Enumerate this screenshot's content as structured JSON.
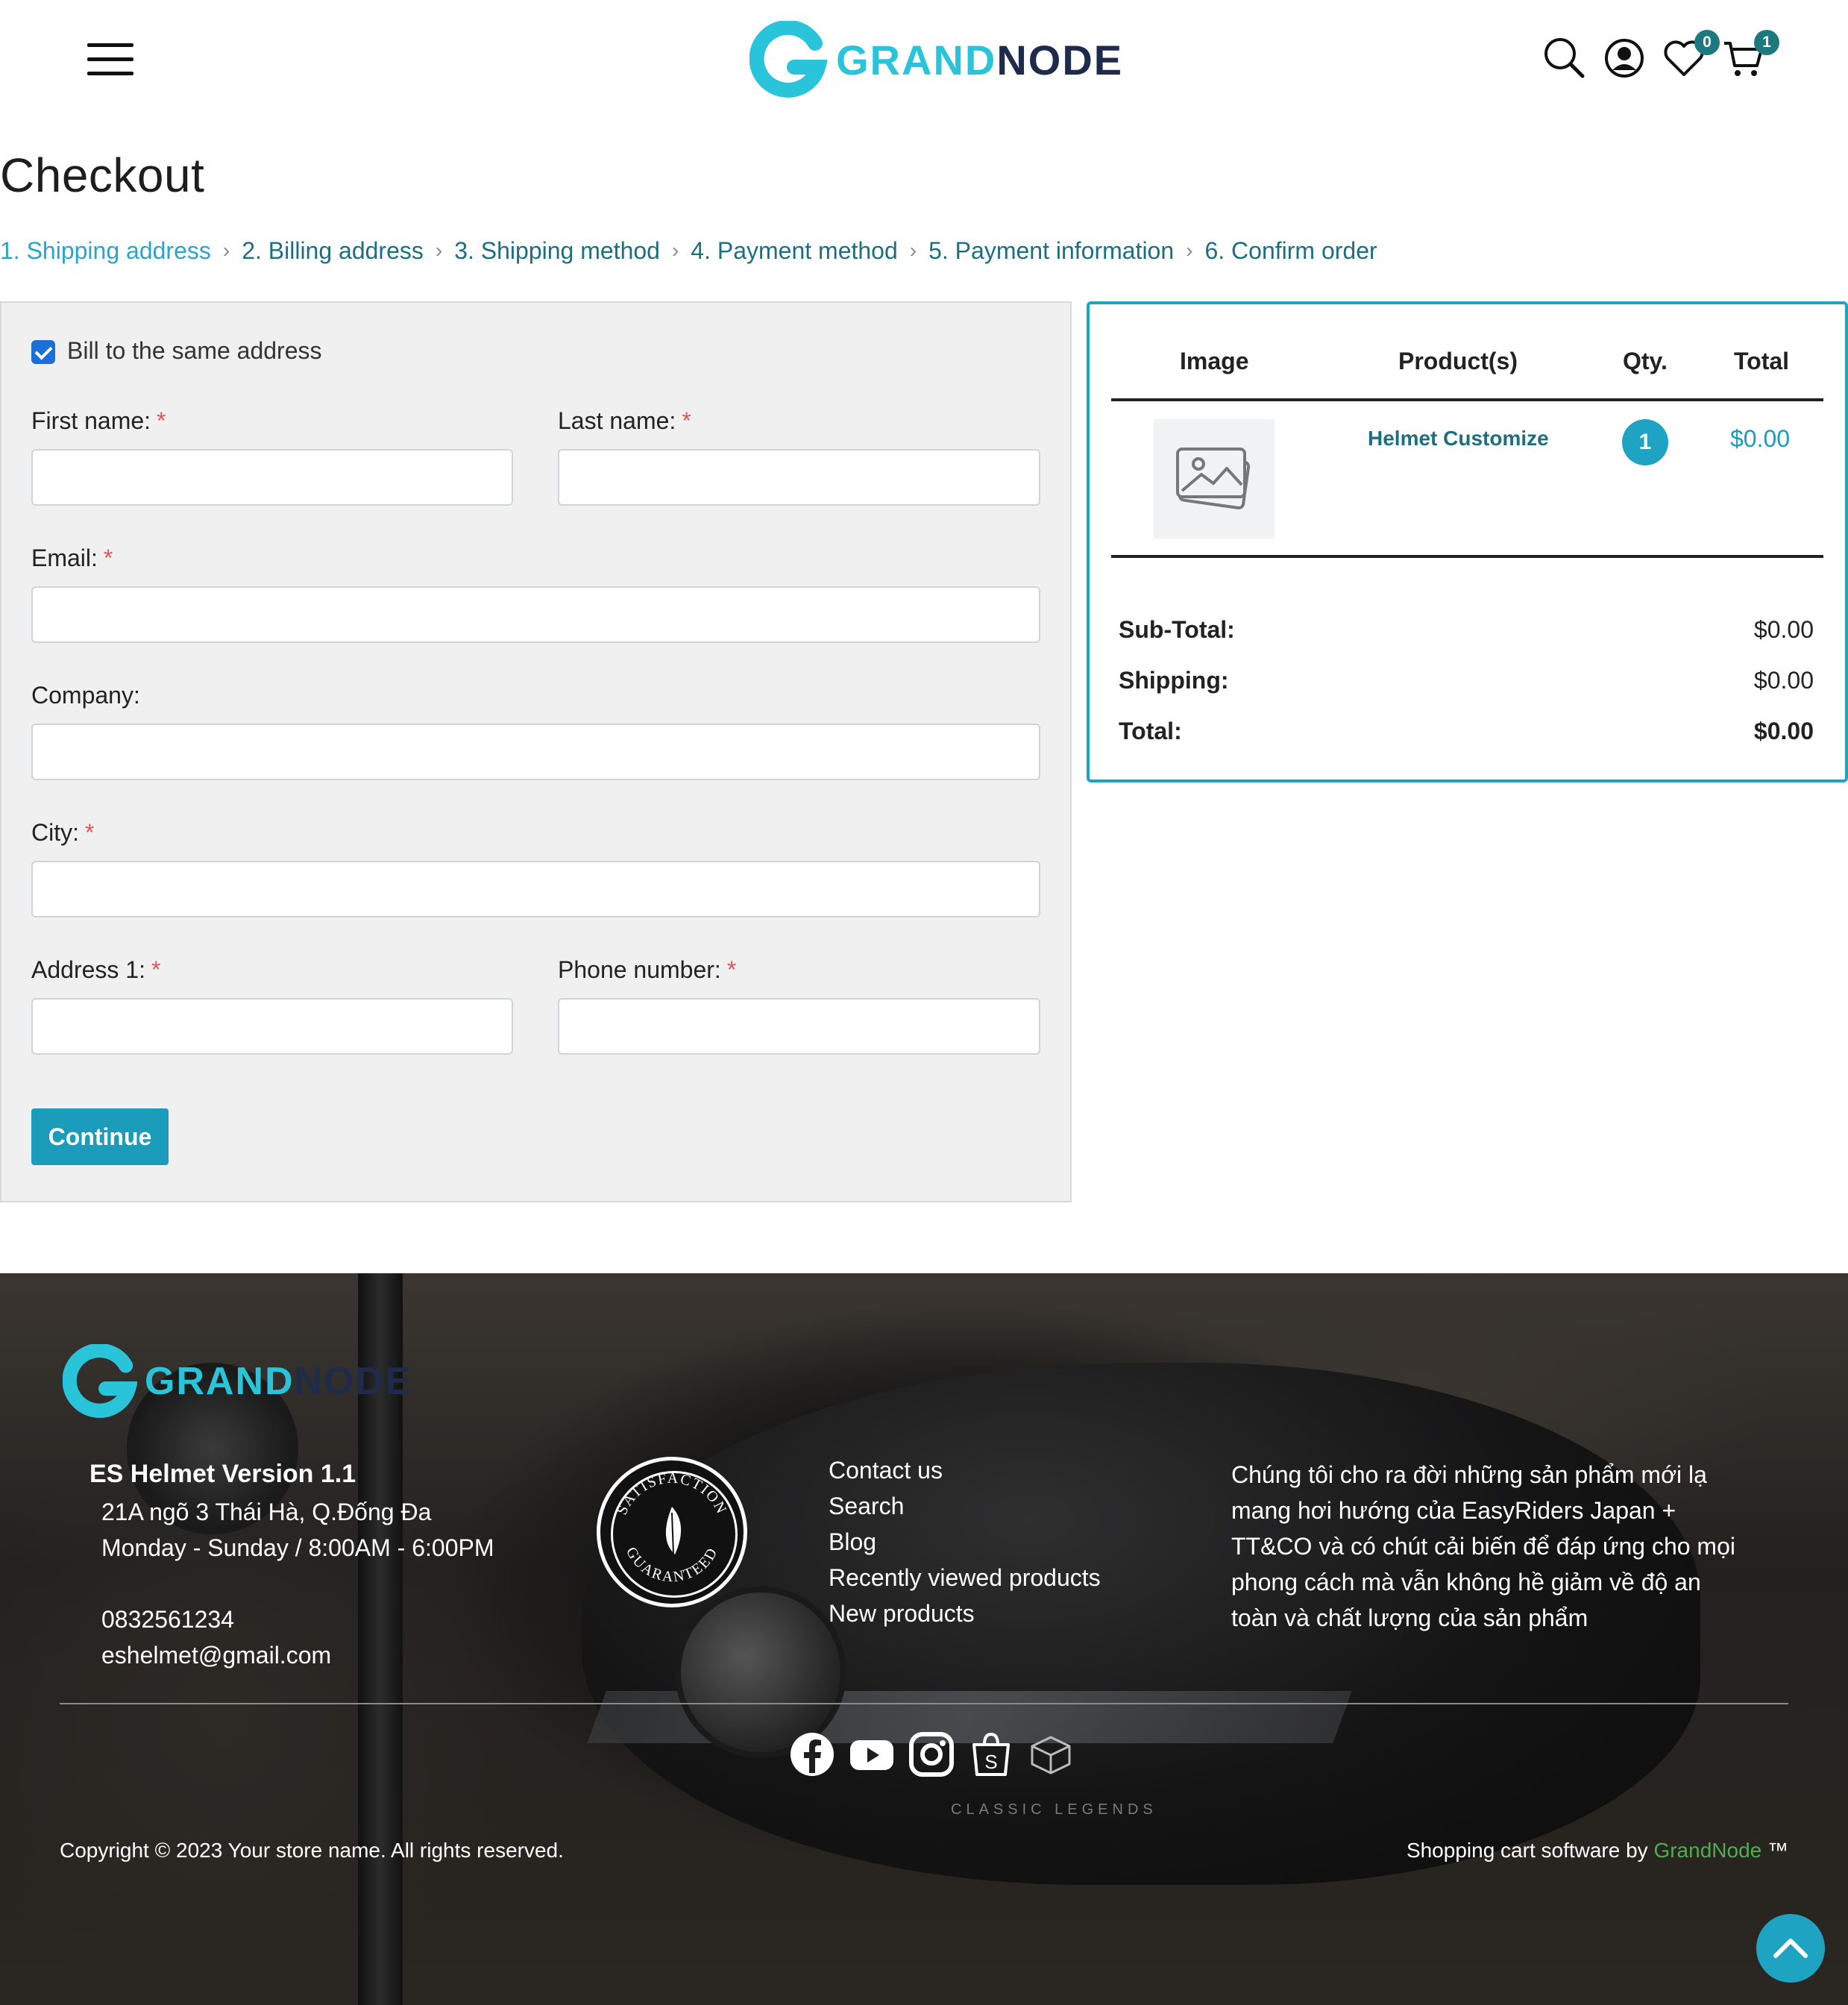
{
  "header": {
    "logo_part1": "GRAND",
    "logo_part2": "NODE",
    "wishlist_count": "0",
    "cart_count": "1"
  },
  "page": {
    "title": "Checkout",
    "steps": [
      {
        "label": "1. Shipping address",
        "active": true
      },
      {
        "label": "2. Billing address",
        "active": false
      },
      {
        "label": "3. Shipping method",
        "active": false
      },
      {
        "label": "4. Payment method",
        "active": false
      },
      {
        "label": "5. Payment information",
        "active": false
      },
      {
        "label": "6. Confirm order",
        "active": false
      }
    ]
  },
  "form": {
    "bill_same_label": "Bill to the same address",
    "bill_same_checked": true,
    "first_name_label": "First name:",
    "last_name_label": "Last name:",
    "email_label": "Email:",
    "company_label": "Company:",
    "city_label": "City:",
    "address1_label": "Address 1:",
    "phone_label": "Phone number:",
    "required_mark": "*",
    "first_name_value": "",
    "last_name_value": "",
    "email_value": "",
    "company_value": "",
    "city_value": "",
    "address1_value": "",
    "phone_value": "",
    "continue_label": "Continue"
  },
  "summary": {
    "headers": {
      "image": "Image",
      "product": "Product(s)",
      "qty": "Qty.",
      "total": "Total"
    },
    "items": [
      {
        "name": "Helmet Customize",
        "qty": "1",
        "total": "$0.00"
      }
    ],
    "subtotal_label": "Sub-Total:",
    "subtotal_value": "$0.00",
    "shipping_label": "Shipping:",
    "shipping_value": "$0.00",
    "total_label": "Total:",
    "total_value": "$0.00"
  },
  "footer": {
    "logo_part1": "GRAND",
    "logo_part2": "NODE",
    "store_name": "ES Helmet Version 1.1",
    "address": "21A ngõ 3 Thái Hà, Q.Đống Đa",
    "hours": "Monday - Sunday / 8:00AM - 6:00PM",
    "phone": "0832561234",
    "email": "eshelmet@gmail.com",
    "seal_top": "SATISFACTION",
    "seal_bottom": "GUARANTEED",
    "links": [
      "Contact us",
      "Search",
      "Blog",
      "Recently viewed products",
      "New products"
    ],
    "description": "Chúng tôi cho ra đời những sản phẩm mới lạ mang hơi hướng của EasyRiders Japan + TT&CO và có chút cải biến để đáp ứng cho mọi phong cách mà vẫn không hề giảm về độ an toàn và chất lượng của sản phẩm",
    "background_text": "CLASSIC LEGENDS",
    "social": [
      "facebook-icon",
      "youtube-icon",
      "instagram-icon",
      "shopee-icon",
      "box-icon"
    ],
    "copyright": "Copyright © 2023 Your store name. All rights reserved.",
    "powered_prefix": "Shopping cart software by ",
    "powered_link": "GrandNode",
    "powered_suffix": " ™"
  },
  "colors": {
    "accent": "#1fa3c2",
    "link": "#1d6e80",
    "required": "#e25555",
    "powered_link": "#4caf50"
  }
}
